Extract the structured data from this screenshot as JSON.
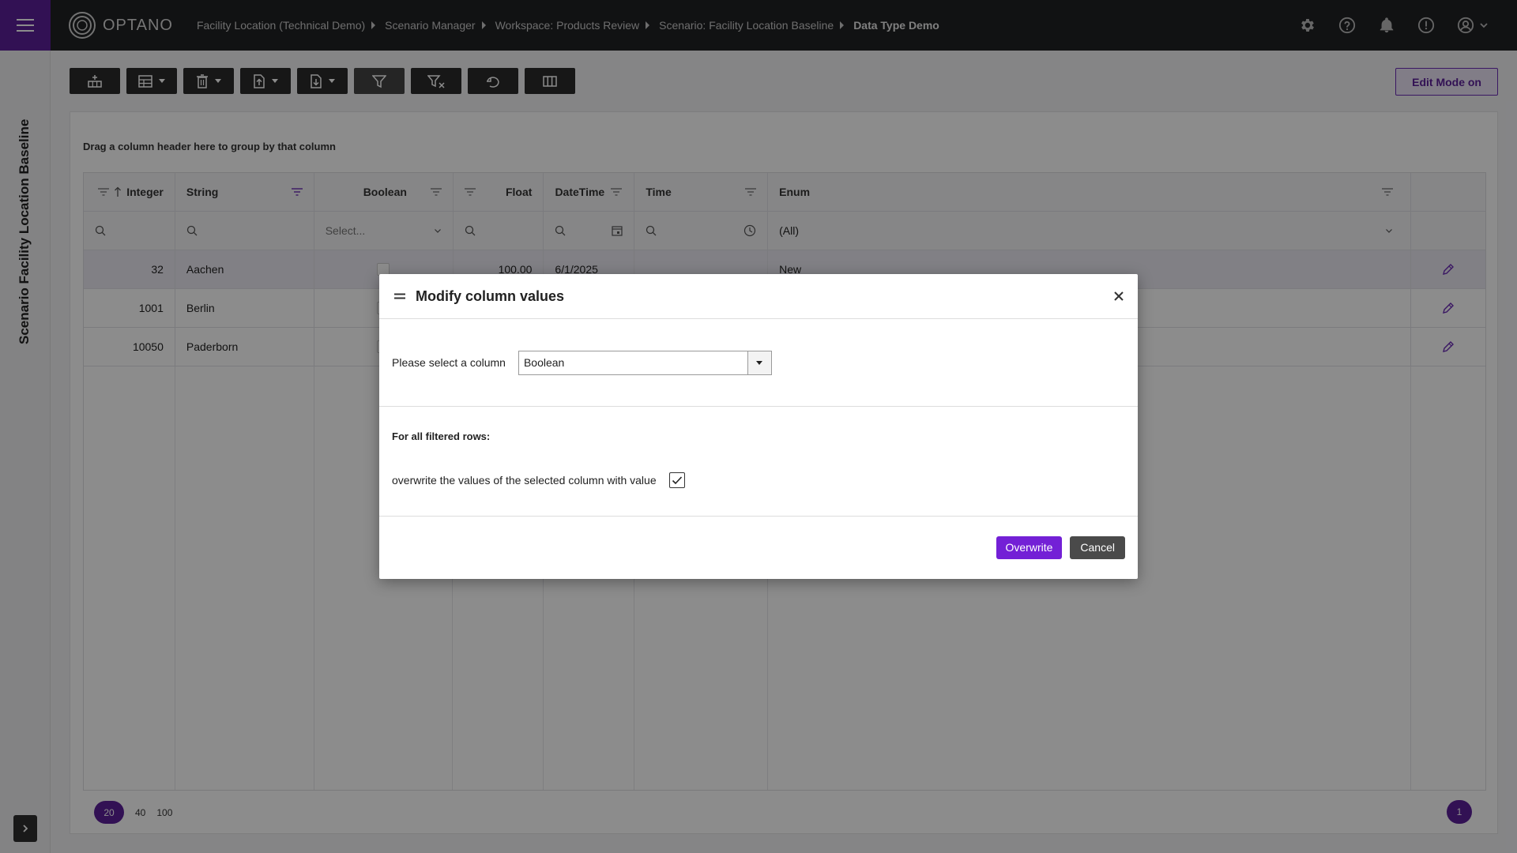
{
  "app": {
    "logo_text": "OPTANO"
  },
  "breadcrumb": [
    "Facility Location (Technical Demo)",
    "Scenario Manager",
    "Workspace: Products Review",
    "Scenario: Facility Location Baseline",
    "Data Type Demo"
  ],
  "sidebar": {
    "vertical_title": "Scenario Facility Location Baseline"
  },
  "toolbar": {
    "edit_mode_label": "Edit Mode on"
  },
  "grid": {
    "group_hint": "Drag a column header here to group by that column",
    "columns": [
      "Integer",
      "String",
      "Boolean",
      "Float",
      "DateTime",
      "Time",
      "Enum"
    ],
    "filters": {
      "boolean_placeholder": "Select...",
      "enum_value": "(All)"
    },
    "rows": [
      {
        "integer": "32",
        "string": "Aachen",
        "float": "100.00",
        "datetime": "6/1/2025",
        "time": "",
        "enum": "New"
      },
      {
        "integer": "1001",
        "string": "Berlin",
        "float": "",
        "datetime": "",
        "time": "",
        "enum": ""
      },
      {
        "integer": "10050",
        "string": "Paderborn",
        "float": "",
        "datetime": "",
        "time": "",
        "enum": ""
      }
    ],
    "page_sizes": [
      "20",
      "40",
      "100"
    ],
    "current_page": "1"
  },
  "dialog": {
    "title": "Modify column values",
    "select_label": "Please select a column",
    "selected_column": "Boolean",
    "section_heading": "For all filtered rows:",
    "overwrite_label": "overwrite the values of the selected column with value",
    "overwrite_checked": true,
    "overwrite_button": "Overwrite",
    "cancel_button": "Cancel"
  },
  "colors": {
    "accent": "#7320d6",
    "brand_dark": "#5b1f9a",
    "topbar": "#202124"
  }
}
